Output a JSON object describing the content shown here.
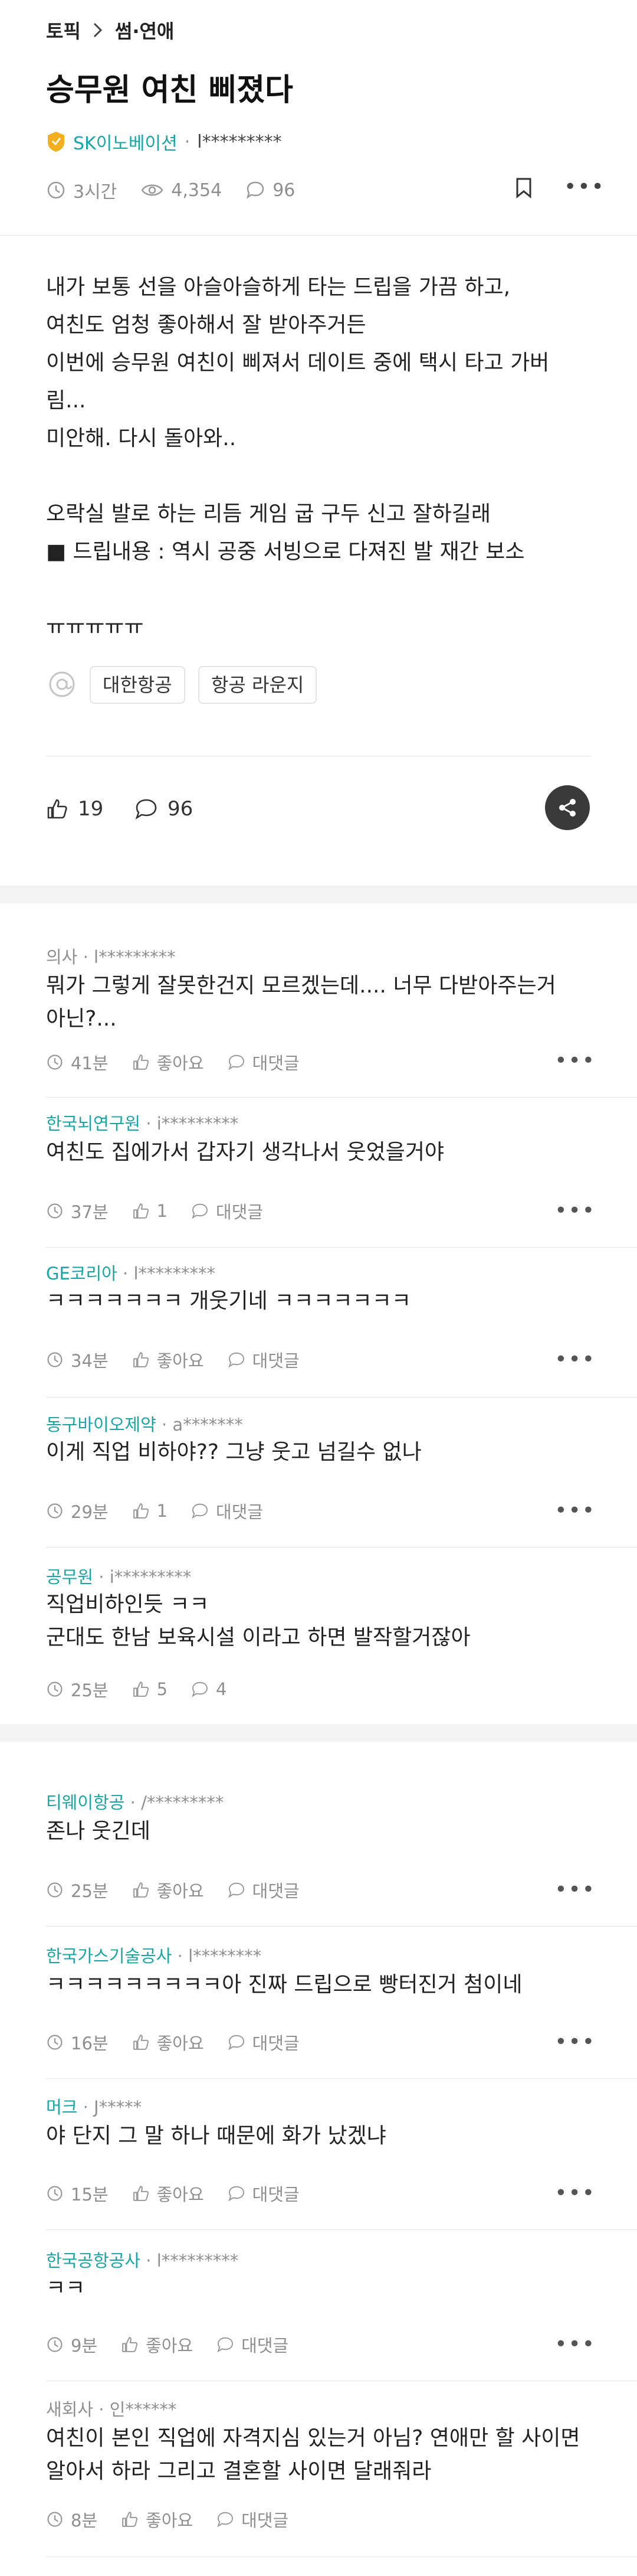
{
  "breadcrumb": {
    "root": "토픽",
    "category": "썸·연애"
  },
  "post": {
    "title": "승무원 여친 삐졌다",
    "author_company": "SK이노베이션",
    "author_id": "l*********",
    "time": "3시간",
    "views": "4,354",
    "comments": "96",
    "body_lines": [
      "내가 보통 선을 아슬아슬하게 타는 드립을 가끔 하고,",
      "여친도 엄청 좋아해서 잘 받아주거든",
      "이번에 승무원 여친이 삐져서 데이트 중에 택시 타고 가버",
      "림...",
      "미안해. 다시 돌아와..",
      "",
      "오락실 발로 하는 리듬 게임 굽 구두 신고 잘하길래",
      "■ 드립내용 : 역시 공중 서빙으로 다져진 발 재간 보소",
      "",
      "ㅠㅠㅠㅠㅠ"
    ],
    "tags": [
      "대한항공",
      "항공 라운지"
    ],
    "likes": "19",
    "comment_count": "96"
  },
  "comments": [
    {
      "company": "의사",
      "user": "l*********",
      "highlight": false,
      "text": "뭐가 그렇게 잘못한건지 모르겠는데.... 너무 다받아주는거 아닌?...",
      "time": "41분",
      "like": "좋아요",
      "reply": "대댓글"
    },
    {
      "company": "한국뇌연구원",
      "user": "i*********",
      "highlight": true,
      "text": "여친도 집에가서 갑자기 생각나서 웃었을거야",
      "time": "37분",
      "like": "1",
      "reply": "대댓글"
    },
    {
      "company": "GE코리아",
      "user": "l*********",
      "highlight": true,
      "text": "ㅋㅋㅋㅋㅋㅋㅋ 개웃기네 ㅋㅋㅋㅋㅋㅋㅋ",
      "time": "34분",
      "like": "좋아요",
      "reply": "대댓글"
    },
    {
      "company": "동구바이오제약",
      "user": "a*******",
      "highlight": true,
      "text": "이게 직업 비하야?? 그냥 웃고 넘길수 없나",
      "time": "29분",
      "like": "1",
      "reply": "대댓글"
    },
    {
      "company": "공무원",
      "user": "i*********",
      "highlight": true,
      "text": "직업비하인듯 ㅋㅋ\n군대도 한남 보육시설 이라고 하면 발작할거잖아",
      "time": "25분",
      "like": "5",
      "reply": "4"
    },
    {
      "company": "티웨이항공",
      "user": "/*********",
      "highlight": true,
      "text": "존나 웃긴데",
      "time": "25분",
      "like": "좋아요",
      "reply": "대댓글"
    },
    {
      "company": "한국가스기술공사",
      "user": "l********",
      "highlight": true,
      "text": "ㅋㅋㅋㅋㅋㅋㅋㅋㅋ아 진짜 드립으로 빵터진거 첨이네",
      "time": "16분",
      "like": "좋아요",
      "reply": "대댓글"
    },
    {
      "company": "머크",
      "user": "J*****",
      "highlight": true,
      "text": "야 단지 그 말 하나 때문에 화가 났겠냐",
      "time": "15분",
      "like": "좋아요",
      "reply": "대댓글"
    },
    {
      "company": "한국공항공사",
      "user": "l*********",
      "highlight": true,
      "text": "ㅋㅋ",
      "time": "9분",
      "like": "좋아요",
      "reply": "대댓글"
    },
    {
      "company": "새회사",
      "user": "인******",
      "highlight": false,
      "text": "여친이 본인 직업에 자격지심 있는거 아님? 연애만 할 사이면 알아서 하라 그리고 결혼할 사이면 달래줘라",
      "time": "8분",
      "like": "좋아요",
      "reply": "대댓글"
    }
  ],
  "colors": {
    "accent": "#1aa5a5",
    "muted": "#8f8f8f",
    "text": "#222222",
    "badge": "#f2b01e"
  }
}
